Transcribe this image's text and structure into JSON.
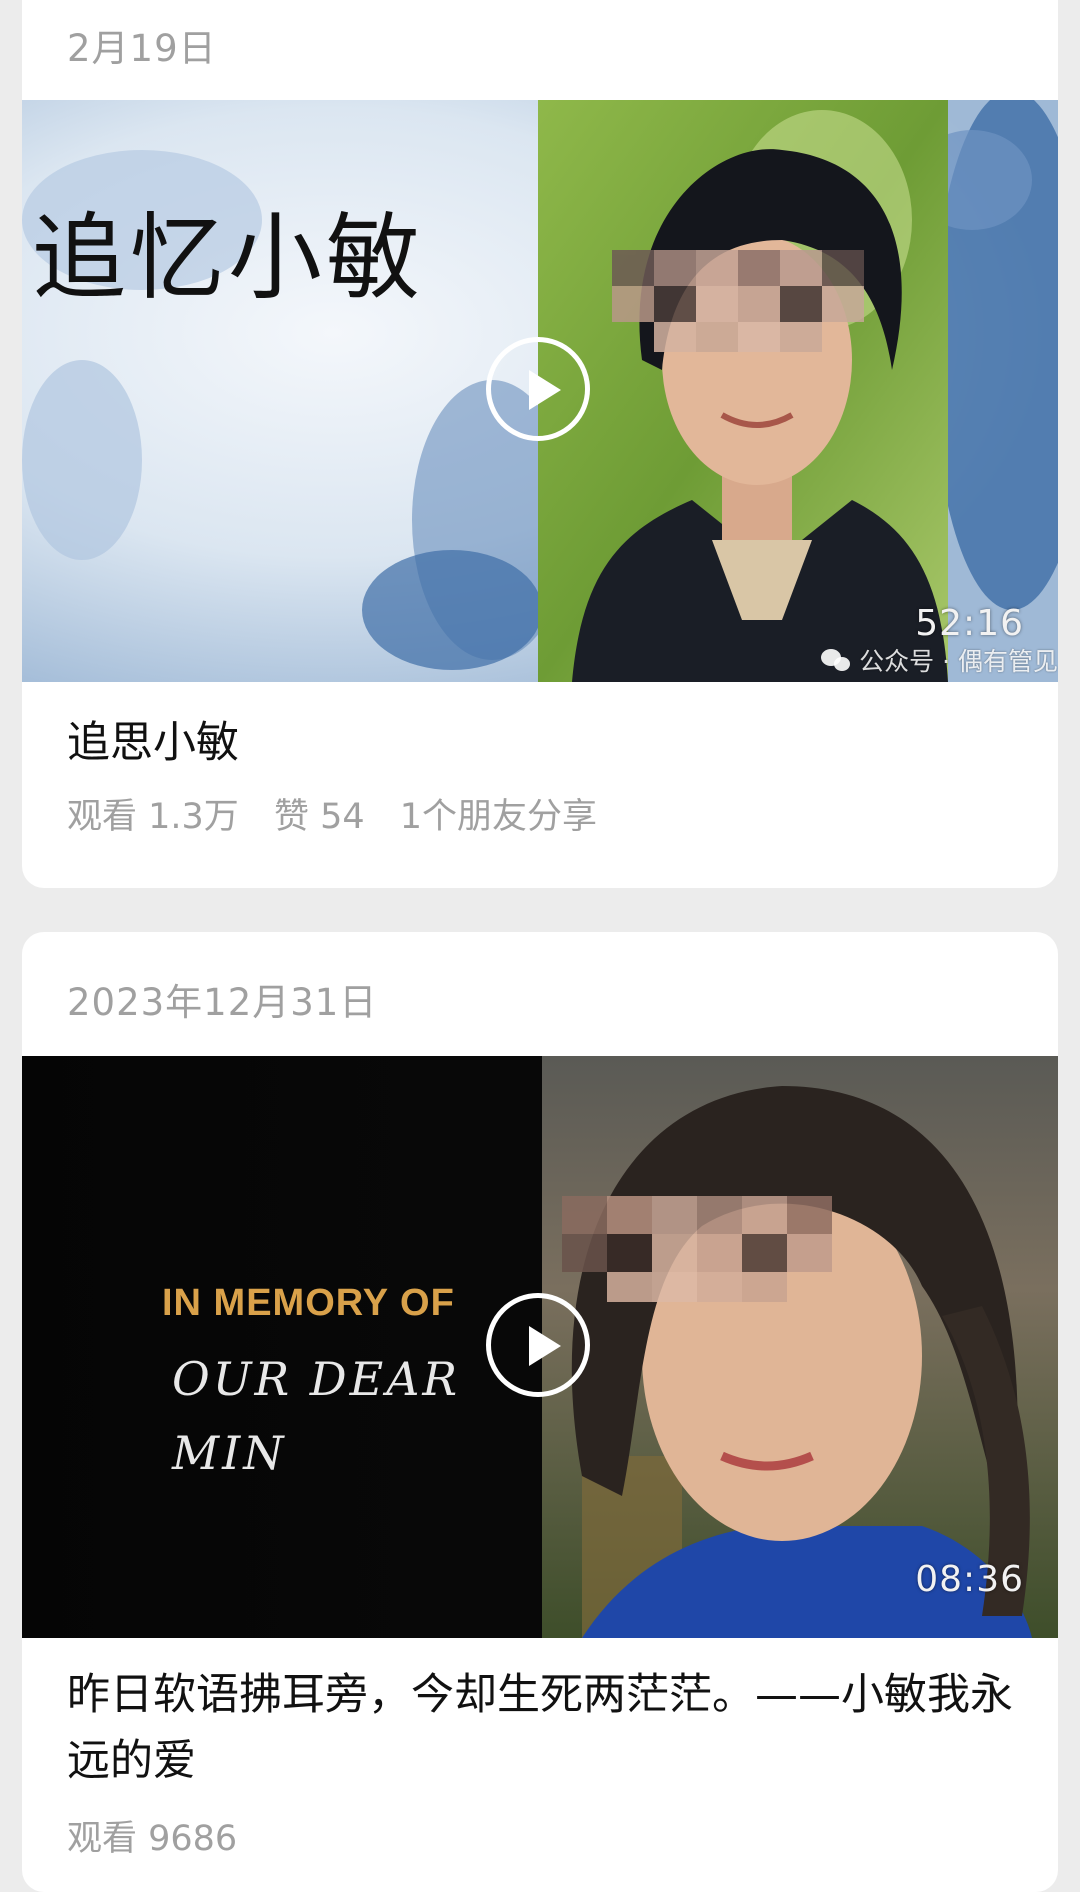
{
  "cards": [
    {
      "date": "2月19日",
      "overlay_text": "追忆小敏",
      "duration": "52:16",
      "watermark": "公众号 · 偶有管见",
      "title": "追思小敏",
      "stats": {
        "views": "观看 1.3万",
        "likes": "赞 54",
        "shares": "1个朋友分享"
      }
    },
    {
      "date": "2023年12月31日",
      "overlay_line1": "IN MEMORY OF",
      "overlay_line2": "OUR DEAR",
      "overlay_line3": "MIN",
      "duration": "08:36",
      "title": "昨日软语拂耳旁，今却生死两茫茫。——小敏我永远的爱",
      "stats": {
        "views": "观看 9686"
      }
    }
  ],
  "icons": {
    "play": "play-icon",
    "wechat": "wechat-icon"
  },
  "colors": {
    "background": "#ececec",
    "card": "#ffffff",
    "meta_text": "#a0a0a0",
    "memory_gold": "#d9a14a"
  }
}
